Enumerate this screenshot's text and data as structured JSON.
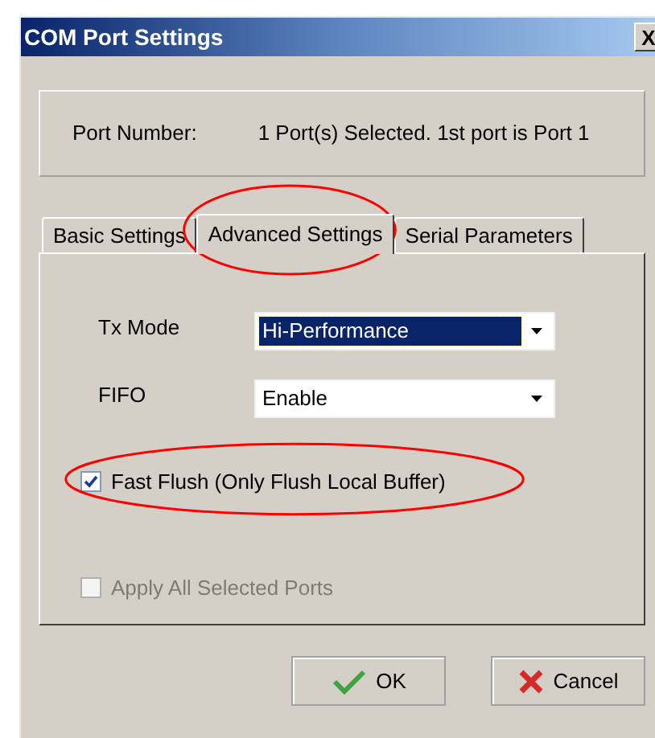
{
  "window": {
    "title": "COM Port Settings",
    "close": "X"
  },
  "port": {
    "label": "Port Number:",
    "value": "1 Port(s) Selected. 1st port is Port 1"
  },
  "tabs": [
    {
      "label": "Basic Settings",
      "selected": false
    },
    {
      "label": "Advanced Settings",
      "selected": true
    },
    {
      "label": "Serial Parameters",
      "selected": false
    }
  ],
  "fields": [
    {
      "label": "Tx Mode",
      "value": "Hi-Performance",
      "focused": true
    },
    {
      "label": "FIFO",
      "value": "Enable",
      "focused": false
    }
  ],
  "checkboxes": [
    {
      "label": "Fast Flush (Only Flush Local Buffer)",
      "checked": true,
      "disabled": false
    },
    {
      "label": "Apply All Selected Ports",
      "checked": false,
      "disabled": true
    }
  ],
  "buttons": [
    {
      "label": "OK",
      "kind": "ok"
    },
    {
      "label": "Cancel",
      "kind": "cancel"
    }
  ]
}
